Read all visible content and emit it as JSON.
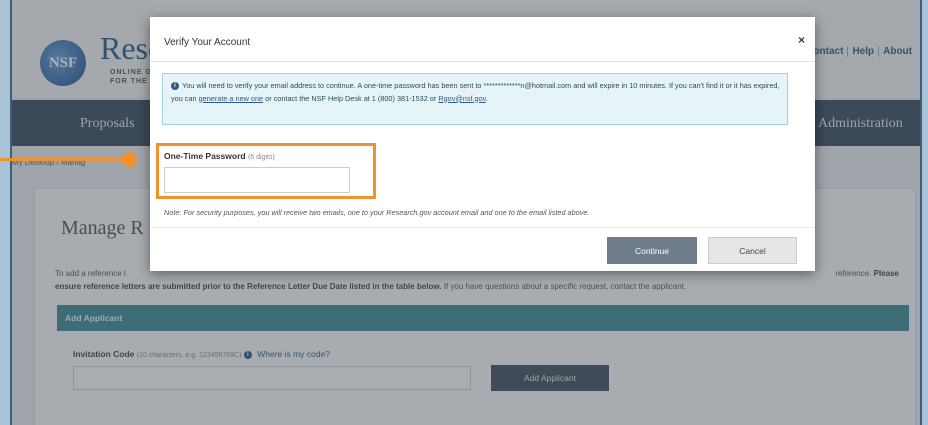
{
  "header": {
    "brand": "Rese",
    "brand_sub_line1": "ONLINE G",
    "brand_sub_line2": "FOR THE N",
    "logo_text": "NSF",
    "links": [
      "Contact",
      "Help",
      "About"
    ]
  },
  "nav": {
    "proposals": "Proposals",
    "administration": "Administration"
  },
  "breadcrumb": "My Desktop / Manag",
  "page": {
    "title": "Manage R",
    "intro_text": "To add a reference l",
    "intro_tail": "reference.",
    "intro_bold_tail": "Please",
    "intro_line2_bold": "ensure reference letters are submitted prior to the Reference Letter Due Date listed in the table below.",
    "intro_line2_rest": "If you have questions about a specific request, contact the applicant.",
    "add_applicant_bar": "Add Applicant",
    "invitation_label": "Invitation Code",
    "invitation_hint": "(10 characters, e.g. 123456789C)",
    "invitation_link": "Where is my code?",
    "add_applicant_button": "Add Applicant"
  },
  "modal": {
    "title": "Verify Your Account",
    "close_symbol": "×",
    "info_part1": "You will need to verify your email address to continue. A one-time password has been sent to *************n@hotmail.com and will expire in 10 minutes. If you can't find it or it has expired, you can",
    "info_link1": "generate a new one",
    "info_part2": "or contact the NSF Help Desk at 1 (800) 381-1532 or",
    "info_link2": "Rgov@nsf.gov",
    "info_part3": ".",
    "otp_label": "One-Time Password",
    "otp_hint": "(6 digits)",
    "otp_value": "",
    "note": "Note: For security purposes, you will receive two emails, one to your Research.gov account email and one to the email listed above.",
    "continue_label": "Continue",
    "cancel_label": "Cancel"
  },
  "colors": {
    "highlight": "#f0932e",
    "navbar": "#3c4d5e",
    "teal_bar": "#3e8a92"
  }
}
